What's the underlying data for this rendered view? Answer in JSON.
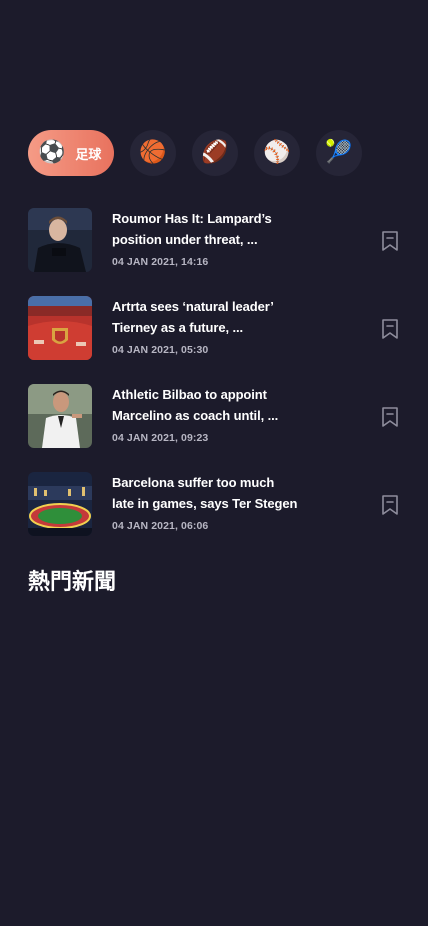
{
  "sports": [
    {
      "icon": "soccer-ball-icon",
      "emoji": "⚽",
      "label": "足球",
      "active": true
    },
    {
      "icon": "basketball-icon",
      "emoji": "🏀"
    },
    {
      "icon": "american-football-icon",
      "emoji": "🏈"
    },
    {
      "icon": "baseball-icon",
      "emoji": "⚾"
    },
    {
      "icon": "tennis-ball-icon",
      "emoji": "🎾"
    }
  ],
  "news": [
    {
      "line1": "Roumor Has It: Lampard’s",
      "line2": "position under threat, ...",
      "time": "04 JAN 2021, 14:16",
      "thumb": "coach-portrait"
    },
    {
      "line1": "Artrta sees ‘natural leader’",
      "line2": "Tierney as a future, ...",
      "time": "04 JAN 2021, 05:30",
      "thumb": "arsenal-stadium"
    },
    {
      "line1": "Athletic Bilbao to appoint",
      "line2": "Marcelino as coach until, ...",
      "time": "04 JAN 2021, 09:23",
      "thumb": "coach-sideline"
    },
    {
      "line1": "Barcelona suffer too much",
      "line2": "late in games, says Ter Stegen",
      "time": "04 JAN 2021, 06:06",
      "thumb": "stadium-night"
    }
  ],
  "section_title": "熱門新聞",
  "colors": {
    "background": "#1c1b2b",
    "chip": "#262537",
    "accent_start": "#f59b86",
    "accent_end": "#e8725e",
    "timestamp": "#b7b6c3",
    "bookmark": "#8e8d9c"
  }
}
